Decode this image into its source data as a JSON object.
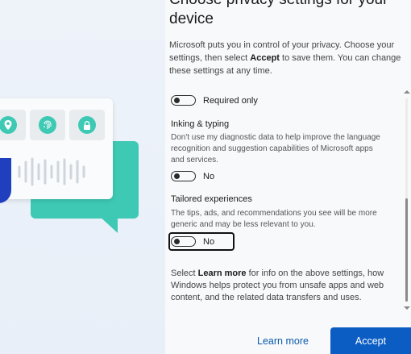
{
  "page": {
    "title": "Choose privacy settings for your device",
    "intro_before": "Microsoft puts you in control of your privacy. Choose your settings, then select ",
    "intro_bold": "Accept",
    "intro_after": " to save them. You can change these settings at any time."
  },
  "settings": {
    "diagnostic": {
      "toggle_label": "Required only",
      "on": false
    },
    "inking": {
      "heading": "Inking & typing",
      "description": "Don't use my diagnostic data to help improve the language recognition and suggestion capabilities of Microsoft apps and services.",
      "toggle_label": "No",
      "on": false
    },
    "tailored": {
      "heading": "Tailored experiences",
      "description": "The tips, ads, and recommendations you see will be more generic and may be less relevant to you.",
      "toggle_label": "No",
      "on": false
    }
  },
  "footer_note": {
    "before": "Select ",
    "bold": "Learn more",
    "after": " for info on the above settings, how Windows helps protect you from unsafe apps and web content, and the related data transfers and uses."
  },
  "buttons": {
    "learn_more": "Learn more",
    "accept": "Accept"
  },
  "colors": {
    "accent": "#0b5cc3",
    "teal": "#3ec9b4"
  }
}
